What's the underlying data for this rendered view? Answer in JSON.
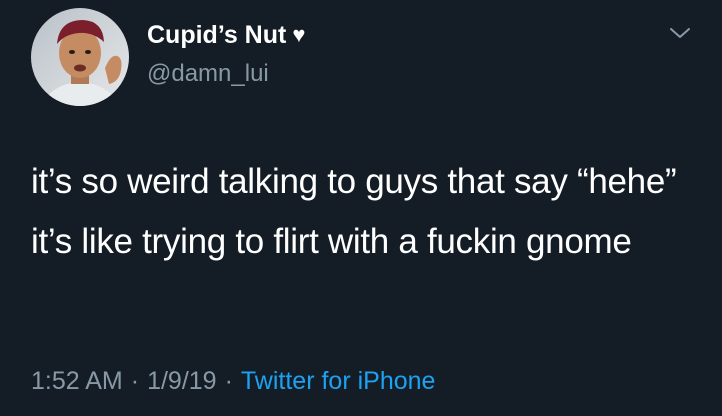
{
  "user": {
    "display_name": "Cupid’s Nut",
    "name_icon": "heart-icon",
    "name_icon_glyph": "♥",
    "handle": "@damn_lui"
  },
  "tweet": {
    "text": "it’s so weird talking to guys that say “hehe” it’s like trying to flirt with a fuckin gnome"
  },
  "meta": {
    "time": "1:52 AM",
    "separator": "·",
    "date": "1/9/19",
    "source": "Twitter for iPhone"
  },
  "menu_icon": "chevron-down-icon",
  "colors": {
    "background": "#141d26",
    "text": "#ffffff",
    "secondary": "#8899a6",
    "link": "#1da1f2"
  }
}
